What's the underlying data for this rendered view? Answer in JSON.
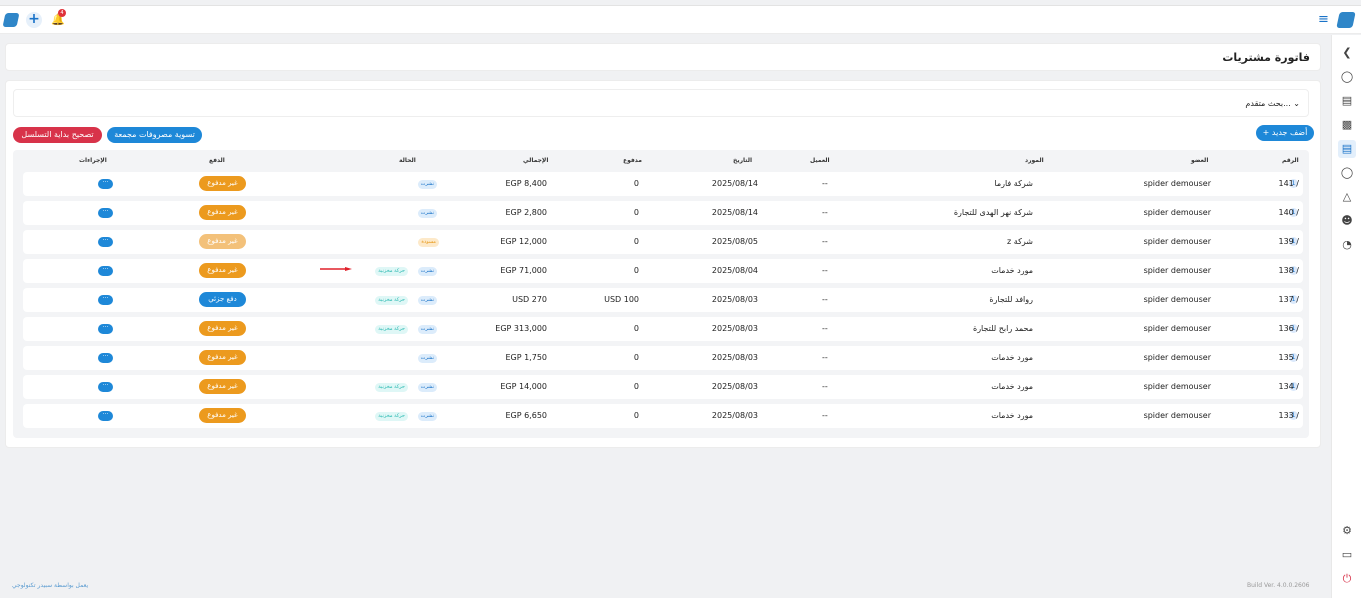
{
  "page": {
    "title": "فاتورة مشتريات"
  },
  "topbar": {
    "notif_count": "4",
    "menu_icon": "≡"
  },
  "search": {
    "label": "بحث متقدم..."
  },
  "buttons": {
    "add_new": "+ أضف جديد",
    "settle": "تسوية مصروفات مجمعة",
    "fix_sequence": "تصحيح بداية التسلسل"
  },
  "table": {
    "headers": {
      "num": "الرقم",
      "member": "العضو",
      "supplier": "المورد",
      "client": "العميل",
      "date": "التاريخ",
      "paid": "مدفوع",
      "total": "الإجمالي",
      "status": "الحالة",
      "payment": "الدفع",
      "actions": "الإجراءات"
    },
    "rows": [
      {
        "num": "141 /",
        "badge": "1",
        "member": "spider demouser",
        "supplier": "شركة فارما",
        "client": "--",
        "date": "2025/08/14",
        "paid": "0",
        "total": "EGP 8,400",
        "status": "نشرت",
        "movement": "",
        "payment": "غير مدفوع",
        "action": "···"
      },
      {
        "num": "140 /",
        "badge": "1",
        "member": "spider demouser",
        "supplier": "شركة نهر الهدى للتجارة",
        "client": "--",
        "date": "2025/08/14",
        "paid": "0",
        "total": "EGP 2,800",
        "status": "نشرت",
        "movement": "",
        "payment": "غير مدفوع",
        "action": "···"
      },
      {
        "num": "139 /",
        "badge": "1",
        "member": "spider demouser",
        "supplier": "شركة z",
        "client": "--",
        "date": "2025/08/05",
        "paid": "0",
        "total": "EGP 12,000",
        "status": "مسودة",
        "movement": "",
        "payment": "غير مدفوع",
        "action": "···"
      },
      {
        "num": "138 /",
        "badge": "1",
        "member": "spider demouser",
        "supplier": "مورد خدمات",
        "client": "--",
        "date": "2025/08/04",
        "paid": "0",
        "total": "EGP 71,000",
        "status": "نشرت",
        "movement": "حركة مخزنية",
        "payment": "غير مدفوع",
        "action": "···"
      },
      {
        "num": "137 /",
        "badge": "1",
        "member": "spider demouser",
        "supplier": "روافد للتجارة",
        "client": "--",
        "date": "2025/08/03",
        "paid": "USD 100",
        "total": "USD 270",
        "status": "نشرت",
        "movement": "حركة مخزنية",
        "payment": "دفع جزئي",
        "action": "···"
      },
      {
        "num": "136 /",
        "badge": "1",
        "member": "spider demouser",
        "supplier": "محمد رابح للتجارة",
        "client": "--",
        "date": "2025/08/03",
        "paid": "0",
        "total": "EGP 313,000",
        "status": "نشرت",
        "movement": "حركة مخزنية",
        "payment": "غير مدفوع",
        "action": "···"
      },
      {
        "num": "135 /",
        "badge": "1",
        "member": "spider demouser",
        "supplier": "مورد خدمات",
        "client": "--",
        "date": "2025/08/03",
        "paid": "0",
        "total": "EGP 1,750",
        "status": "نشرت",
        "movement": "",
        "payment": "غير مدفوع",
        "action": "···"
      },
      {
        "num": "134 /",
        "badge": "1",
        "member": "spider demouser",
        "supplier": "مورد خدمات",
        "client": "--",
        "date": "2025/08/03",
        "paid": "0",
        "total": "EGP 14,000",
        "status": "نشرت",
        "movement": "حركة مخزنية",
        "payment": "غير مدفوع",
        "action": "···"
      },
      {
        "num": "133 /",
        "badge": "1",
        "member": "spider demouser",
        "supplier": "مورد خدمات",
        "client": "--",
        "date": "2025/08/03",
        "paid": "0",
        "total": "EGP 6,650",
        "status": "نشرت",
        "movement": "حركة مخزنية",
        "payment": "غير مدفوع",
        "action": "···"
      }
    ]
  },
  "footer": {
    "powered": "يعمل بواسطة سبيدر تكنولوجي",
    "build": "Build Ver. 4.0.0.2606"
  },
  "colors": {
    "primary": "#1e88d8",
    "danger": "#d8334a",
    "unpaid": "#ec9a1e"
  }
}
